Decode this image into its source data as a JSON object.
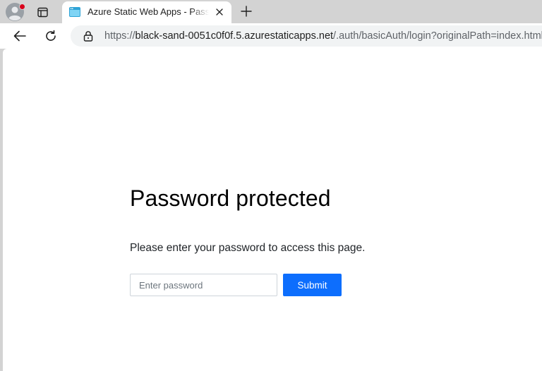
{
  "browser": {
    "tab": {
      "title": "Azure Static Web Apps - Password protected",
      "favicon": "browser-window-icon"
    },
    "address_bar": {
      "scheme": "https://",
      "host": "black-sand-0051c0f0f.5.azurestaticapps.net",
      "path": "/.auth/basicAuth/login?originalPath=index.html"
    },
    "icons": {
      "profile": "profile-avatar-icon",
      "notification": "notification-dot",
      "tab_actions": "tab-actions-icon",
      "close_tab": "close-icon",
      "new_tab": "plus-icon",
      "back": "back-arrow-icon",
      "reload": "reload-icon",
      "security": "lock-icon"
    },
    "colors": {
      "chrome": "#d3d3d3",
      "notification_dot": "#d9001b"
    }
  },
  "page": {
    "heading": "Password protected",
    "description": "Please enter your password to access this page.",
    "password_input": {
      "placeholder": "Enter password",
      "value": ""
    },
    "submit_label": "Submit",
    "colors": {
      "primary_button": "#0d6efd"
    }
  }
}
